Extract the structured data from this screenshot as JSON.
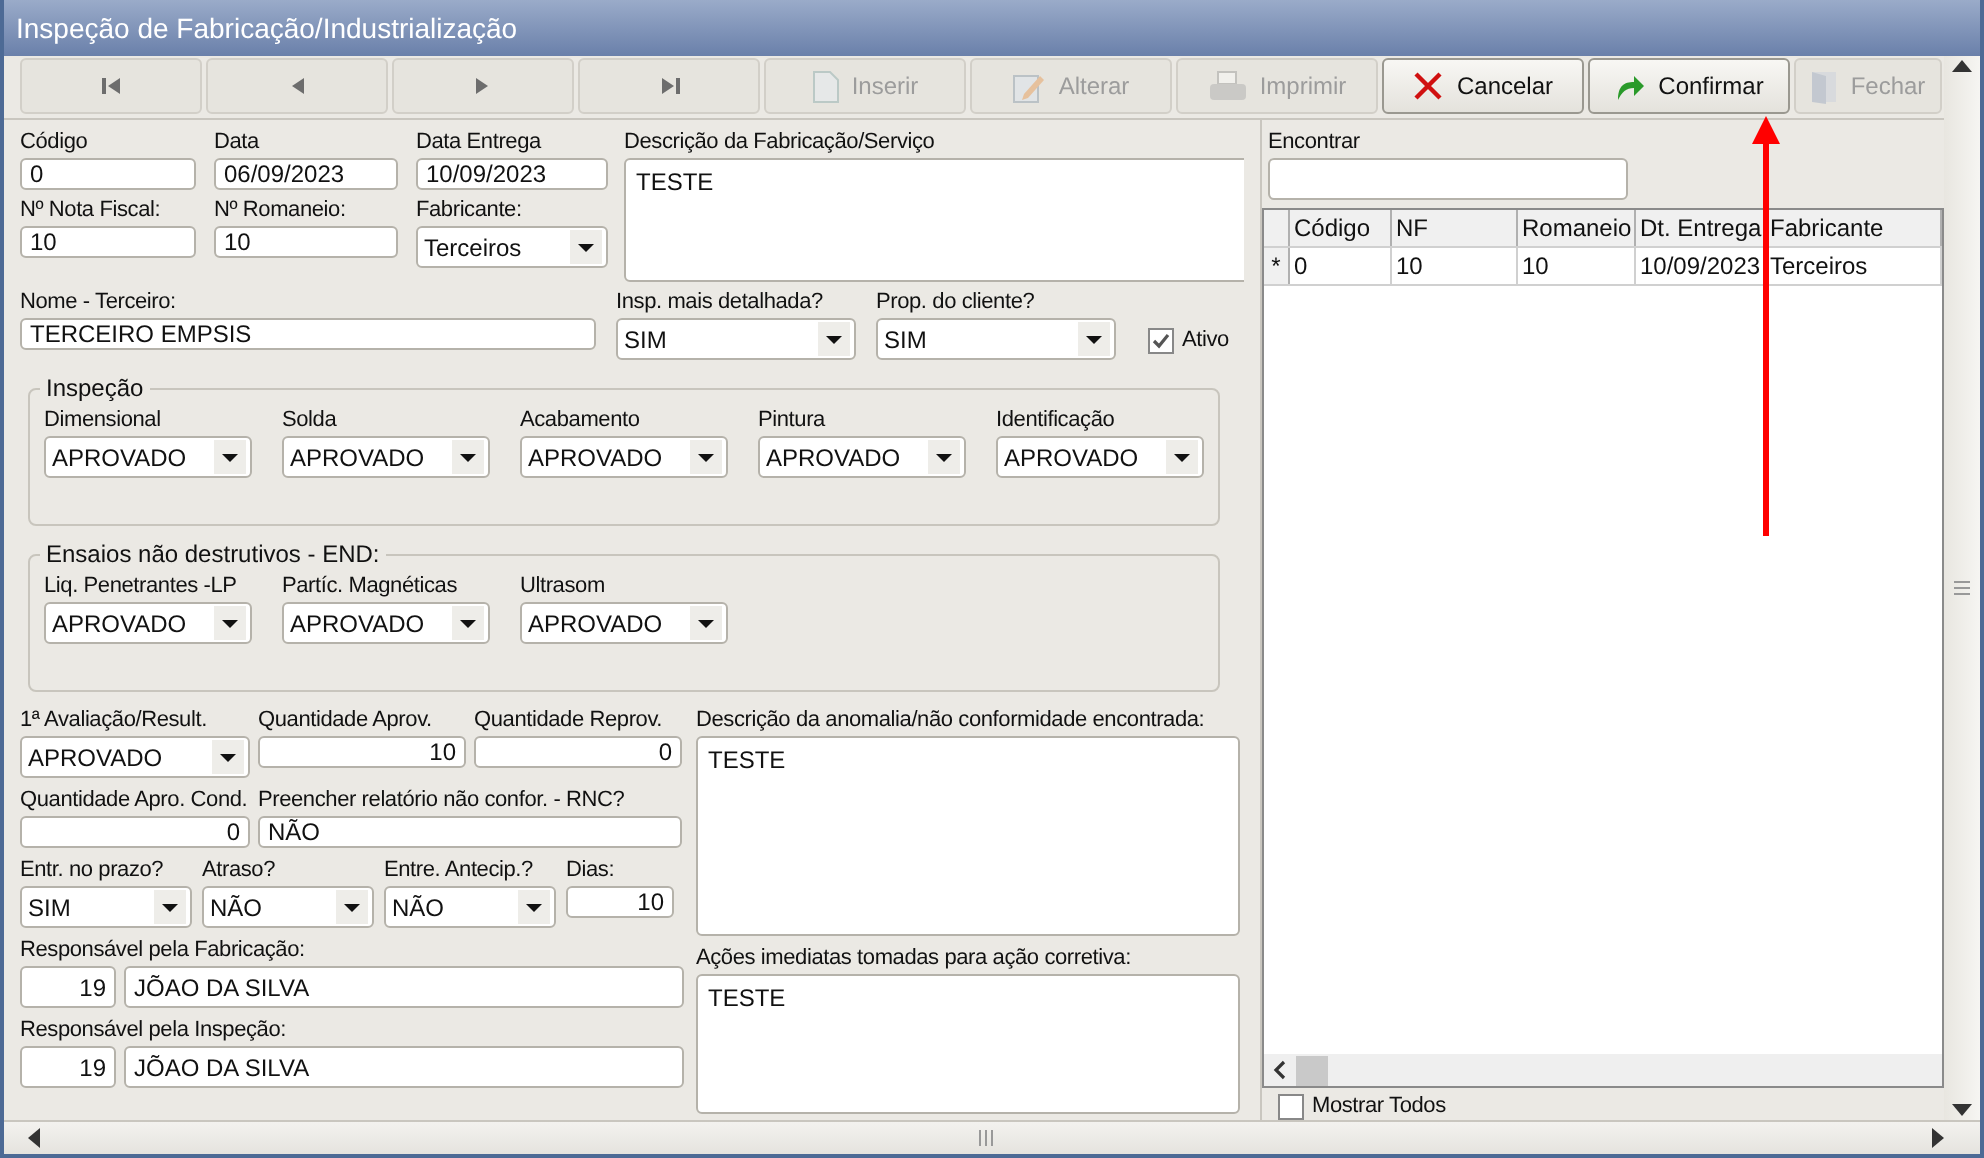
{
  "window": {
    "title": "Inspeção de Fabricação/Industrialização"
  },
  "toolbar": {
    "nav": [
      {
        "kind": "first"
      },
      {
        "kind": "prev"
      },
      {
        "kind": "next"
      },
      {
        "kind": "last"
      }
    ],
    "actions": [
      {
        "label": "Inserir",
        "kind": "document",
        "disabled": true
      },
      {
        "label": "Alterar",
        "kind": "pencil",
        "disabled": true
      },
      {
        "label": "Imprimir",
        "kind": "printer",
        "disabled": true
      },
      {
        "label": "Cancelar",
        "kind": "cross",
        "disabled": false
      },
      {
        "label": "Confirmar",
        "kind": "redo",
        "disabled": false
      },
      {
        "label": "Fechar",
        "kind": "door",
        "disabled": true
      }
    ]
  },
  "header": {
    "codigo": {
      "label": "Código",
      "value": "0"
    },
    "data": {
      "label": "Data",
      "value": "06/09/2023"
    },
    "data_entrega": {
      "label": "Data Entrega",
      "value": "10/09/2023"
    },
    "descricao": {
      "label": "Descrição da Fabricação/Serviço",
      "value": "TESTE"
    },
    "nota_fiscal": {
      "label": "Nº Nota Fiscal:",
      "value": "10"
    },
    "romaneio": {
      "label": "Nº Romaneio:",
      "value": "10"
    },
    "fabricante": {
      "label": "Fabricante:",
      "value": "Terceiros"
    },
    "nome_terceiro": {
      "label": "Nome - Terceiro:",
      "value": "TERCEIRO EMPSIS"
    },
    "insp_detalhada": {
      "label": "Insp. mais detalhada?",
      "value": "SIM"
    },
    "prop_cliente": {
      "label": "Prop. do cliente?",
      "value": "SIM"
    },
    "ativo": {
      "label": "Ativo",
      "checked": true
    }
  },
  "inspecao": {
    "title": "Inspeção",
    "items": [
      {
        "label": "Dimensional",
        "value": "APROVADO"
      },
      {
        "label": "Solda",
        "value": "APROVADO"
      },
      {
        "label": "Acabamento",
        "value": "APROVADO"
      },
      {
        "label": "Pintura",
        "value": "APROVADO"
      },
      {
        "label": "Identificação",
        "value": "APROVADO"
      }
    ]
  },
  "ensaios": {
    "title": "Ensaios não destrutivos - END:",
    "items": [
      {
        "label": "Liq. Penetrantes -LP",
        "value": "APROVADO"
      },
      {
        "label": "Partíc. Magnéticas",
        "value": "APROVADO"
      },
      {
        "label": "Ultrasom",
        "value": "APROVADO"
      }
    ]
  },
  "resultado": {
    "avaliacao": {
      "label": "1ª Avaliação/Result.",
      "value": "APROVADO"
    },
    "qtd_aprov": {
      "label": "Quantidade Aprov.",
      "value": "10"
    },
    "qtd_reprov": {
      "label": "Quantidade Reprov.",
      "value": "0"
    },
    "qtd_cond": {
      "label": "Quantidade Apro. Cond.",
      "value": "0"
    },
    "rnc": {
      "label": "Preencher relatório não confor. - RNC?",
      "value": "NÃO"
    },
    "prazo": {
      "label": "Entr. no prazo?",
      "value": "SIM"
    },
    "atraso": {
      "label": "Atraso?",
      "value": "NÃO"
    },
    "antecip": {
      "label": "Entre. Antecip.?",
      "value": "NÃO"
    },
    "dias": {
      "label": "Dias:",
      "value": "10"
    },
    "resp_fab": {
      "label": "Responsável pela Fabricação:",
      "code": "19",
      "name": "JÕAO DA SILVA"
    },
    "resp_insp": {
      "label": "Responsável pela Inspeção:",
      "code": "19",
      "name": "JÕAO DA SILVA"
    }
  },
  "anomalia": {
    "label": "Descrição da anomalia/não conformidade encontrada:",
    "value": "TESTE"
  },
  "acoes": {
    "label": "Ações imediatas tomadas para ação corretiva:",
    "value": "TESTE"
  },
  "search": {
    "label": "Encontrar"
  },
  "grid": {
    "columns": [
      "Código",
      "NF",
      "Romaneio",
      "Dt. Entrega",
      "Fabricante"
    ],
    "rows": [
      {
        "marker": "*",
        "cells": [
          "0",
          "10",
          "10",
          "10/09/2023",
          "Terceiros"
        ]
      }
    ]
  },
  "show_all": {
    "label": "Mostrar Todos",
    "checked": false
  }
}
